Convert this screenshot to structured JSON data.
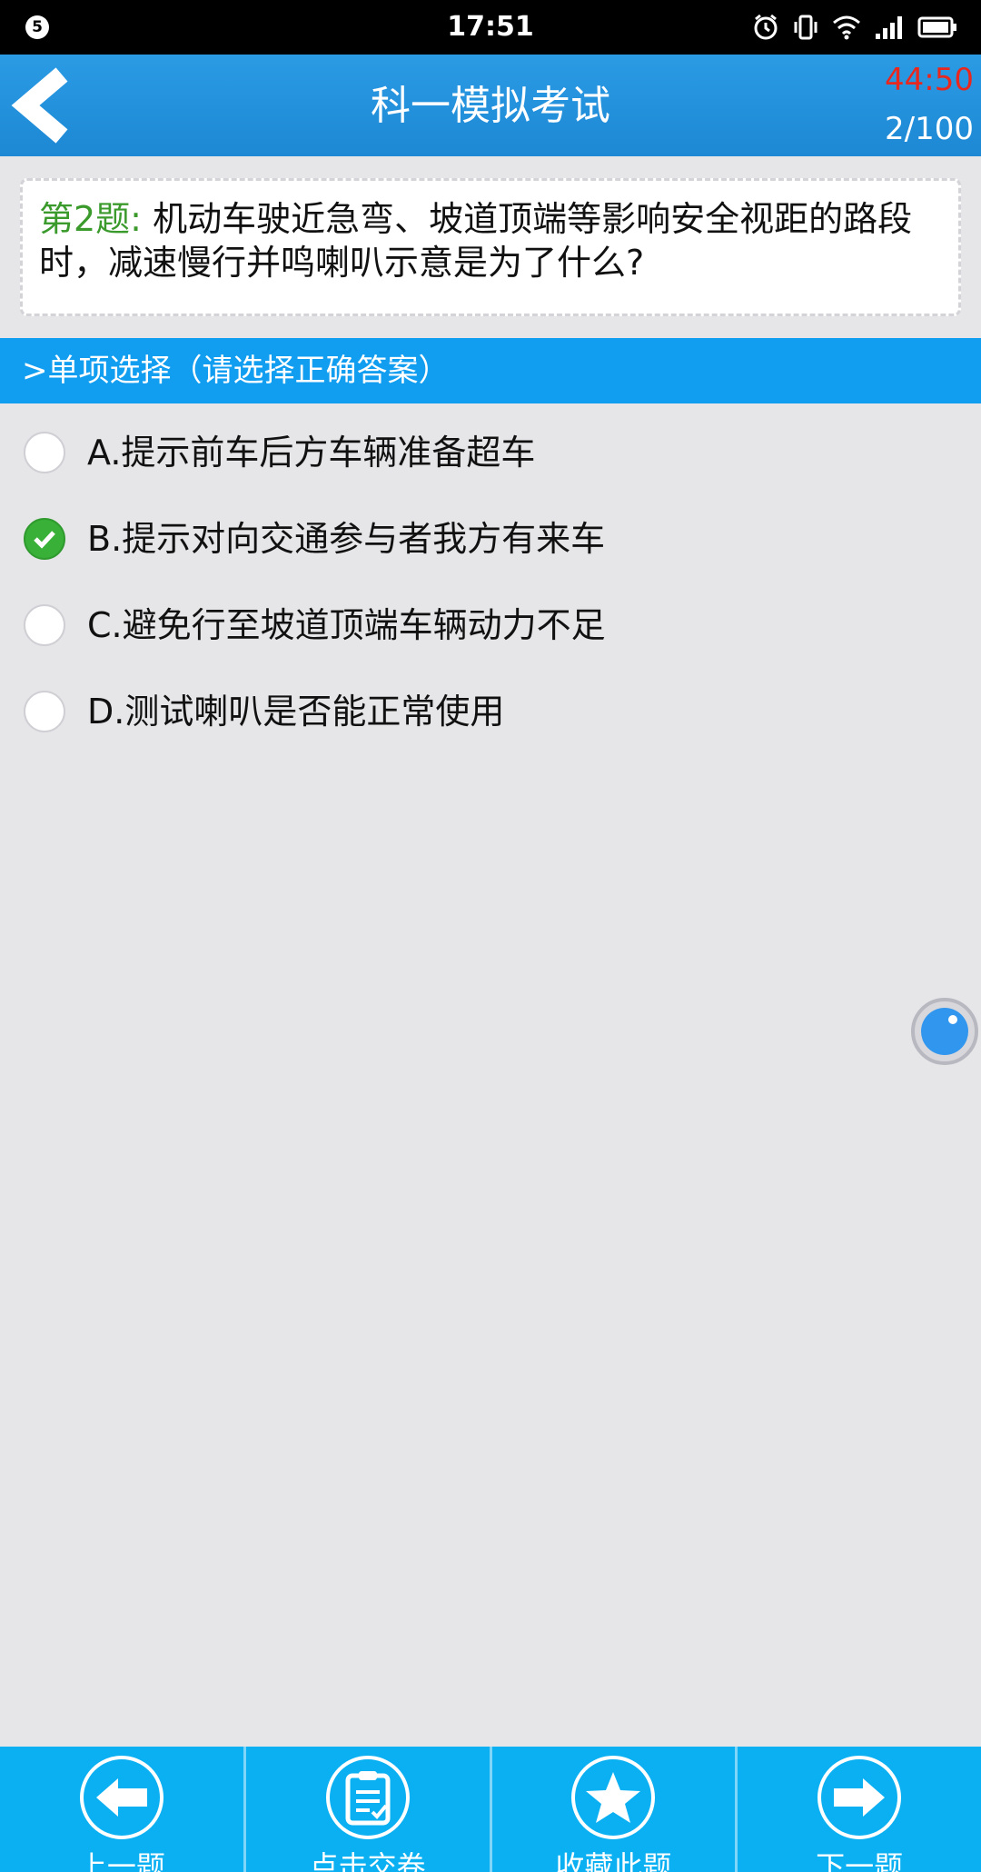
{
  "status_bar": {
    "notification_count": "5",
    "time": "17:51",
    "icons": [
      "alarm-icon",
      "vibrate-icon",
      "wifi-icon",
      "signal-icon",
      "battery-icon"
    ]
  },
  "header": {
    "title": "科一模拟考试",
    "timer": "44:50",
    "progress": "2/100",
    "back_icon": "chevron-left-icon"
  },
  "question": {
    "number_label": "第2题:",
    "text": " 机动车驶近急弯、坡道顶端等影响安全视距的路段时，减速慢行并鸣喇叭示意是为了什么?"
  },
  "section": {
    "label": ">单项选择（请选择正确答案）"
  },
  "options": [
    {
      "label": "A.提示前车后方车辆准备超车",
      "selected": false
    },
    {
      "label": "B.提示对向交通参与者我方有来车",
      "selected": true
    },
    {
      "label": "C.避免行至坡道顶端车辆动力不足",
      "selected": false
    },
    {
      "label": "D.测试喇叭是否能正常使用",
      "selected": false
    }
  ],
  "bottom_nav": [
    {
      "label": "上一题",
      "icon": "arrow-left-icon"
    },
    {
      "label": "点击交卷",
      "icon": "clipboard-icon"
    },
    {
      "label": "收藏此题",
      "icon": "star-icon"
    },
    {
      "label": "下一题",
      "icon": "arrow-right-icon"
    }
  ],
  "colors": {
    "header_blue": "#1d88d4",
    "section_blue": "#119ef0",
    "nav_blue": "#0ab0f2",
    "timer_red": "#e8281e",
    "question_green": "#3b9a2c",
    "check_green": "#39b037"
  }
}
